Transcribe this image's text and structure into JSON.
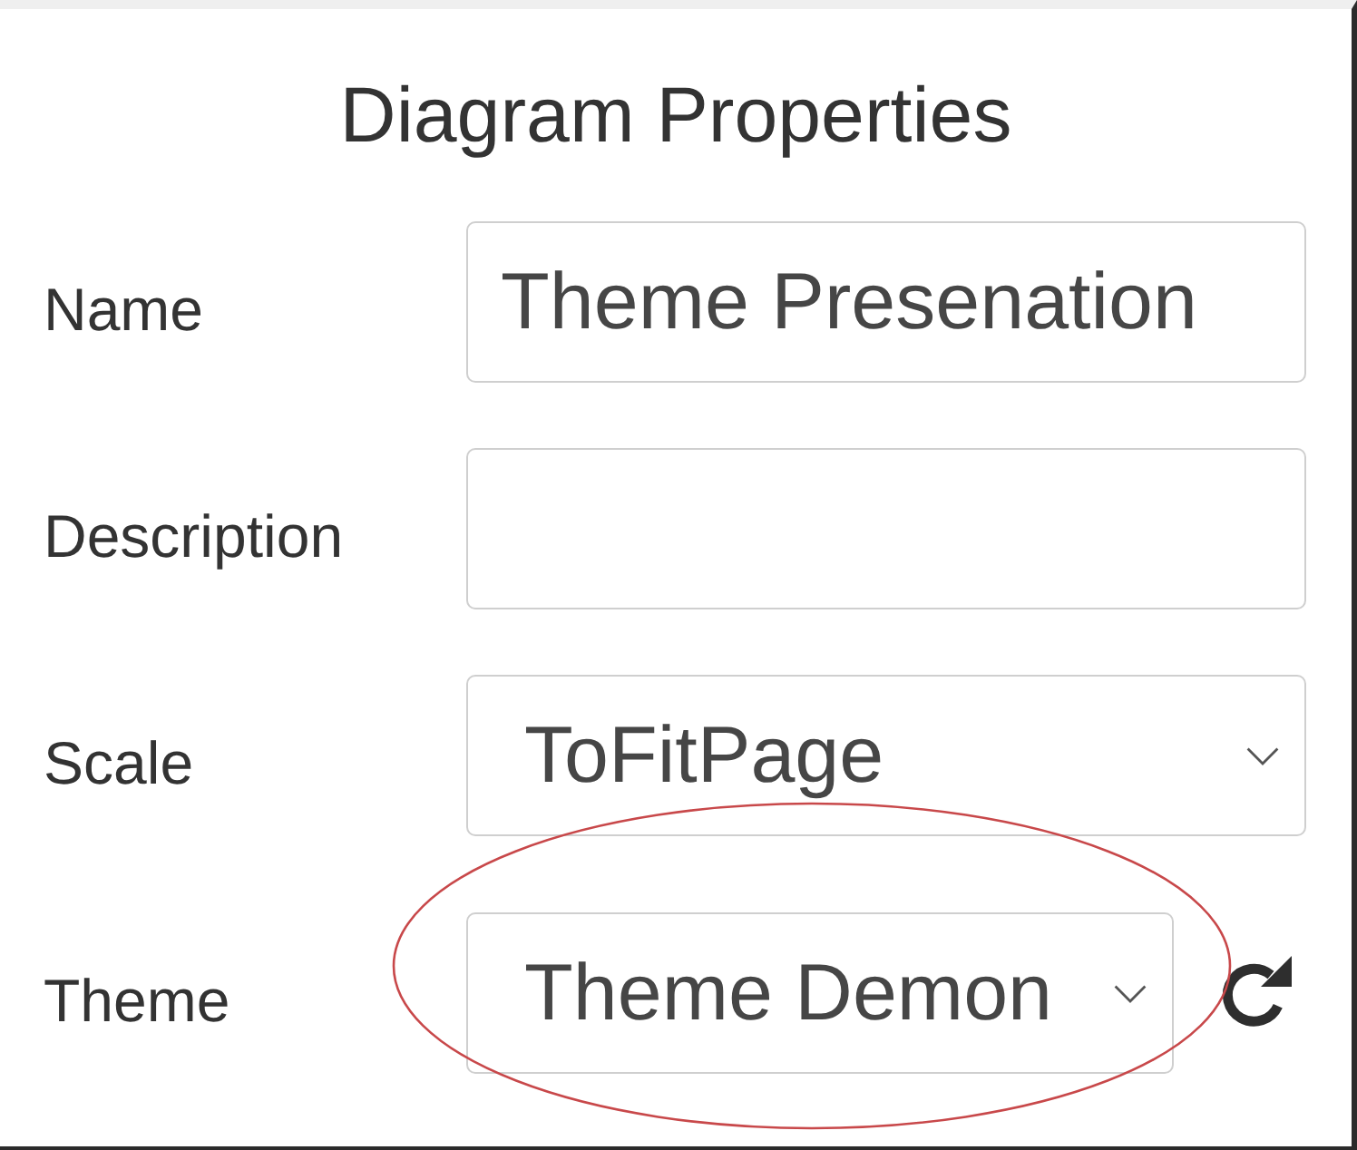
{
  "panel": {
    "title": "Diagram Properties"
  },
  "fields": [
    {
      "kind": "text",
      "label": "Name",
      "value": "Theme Presenation",
      "highlighted": false
    },
    {
      "kind": "text",
      "label": "Description",
      "highlighted": false
    },
    {
      "kind": "select",
      "label": "Scale",
      "value": "ToFitPage",
      "highlighted": false
    },
    {
      "kind": "select",
      "label": "Theme",
      "value": "Theme Demon",
      "has_refresh": true,
      "highlighted": true
    }
  ]
}
